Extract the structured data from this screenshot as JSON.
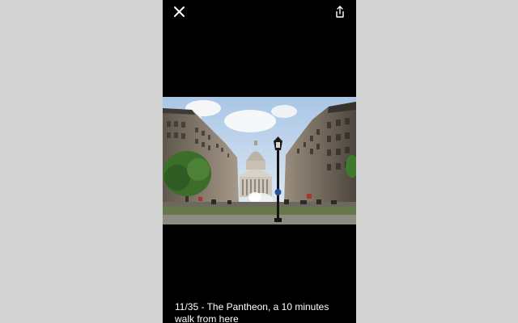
{
  "viewer": {
    "close_icon": "close-icon",
    "share_icon": "share-icon",
    "photo_index": "11/35",
    "caption": "11/35 - The Pantheon, a 10 minutes walk from here",
    "photo_subject": "The Pantheon street view"
  },
  "colors": {
    "page_background": "#d2d2d2",
    "viewer_background": "#000000",
    "caption_text": "#ffffff"
  }
}
